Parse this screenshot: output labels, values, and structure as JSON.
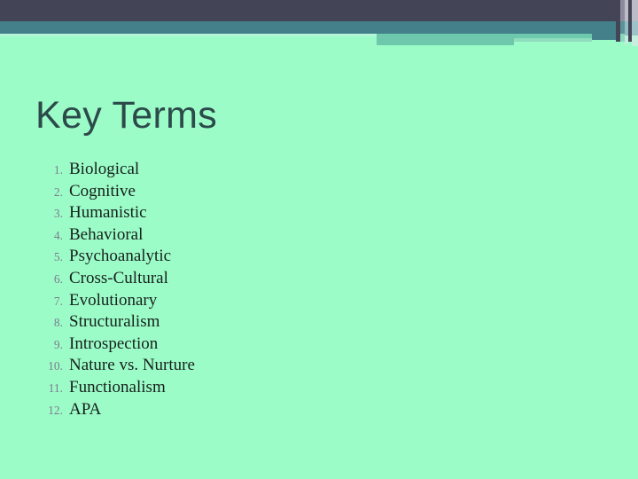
{
  "slide": {
    "title": "Key Terms",
    "background_color": "#9cfcc8",
    "title_color": "#2c4a4a",
    "accent_dark": "#434456",
    "accent_teal": "#43808a",
    "accent_green": "#6dc8ac",
    "number_color": "#7c7c8c",
    "text_color": "#16201c"
  },
  "terms": [
    {
      "number": "1.",
      "label": "Biological"
    },
    {
      "number": "2.",
      "label": "Cognitive"
    },
    {
      "number": "3.",
      "label": "Humanistic"
    },
    {
      "number": "4.",
      "label": "Behavioral"
    },
    {
      "number": "5.",
      "label": "Psychoanalytic"
    },
    {
      "number": "6.",
      "label": "Cross-Cultural"
    },
    {
      "number": "7.",
      "label": "Evolutionary"
    },
    {
      "number": "8.",
      "label": "Structuralism"
    },
    {
      "number": "9.",
      "label": "Introspection"
    },
    {
      "number": "10.",
      "label": "Nature vs. Nurture"
    },
    {
      "number": "11.",
      "label": "Functionalism"
    },
    {
      "number": "12.",
      "label": "APA"
    }
  ]
}
